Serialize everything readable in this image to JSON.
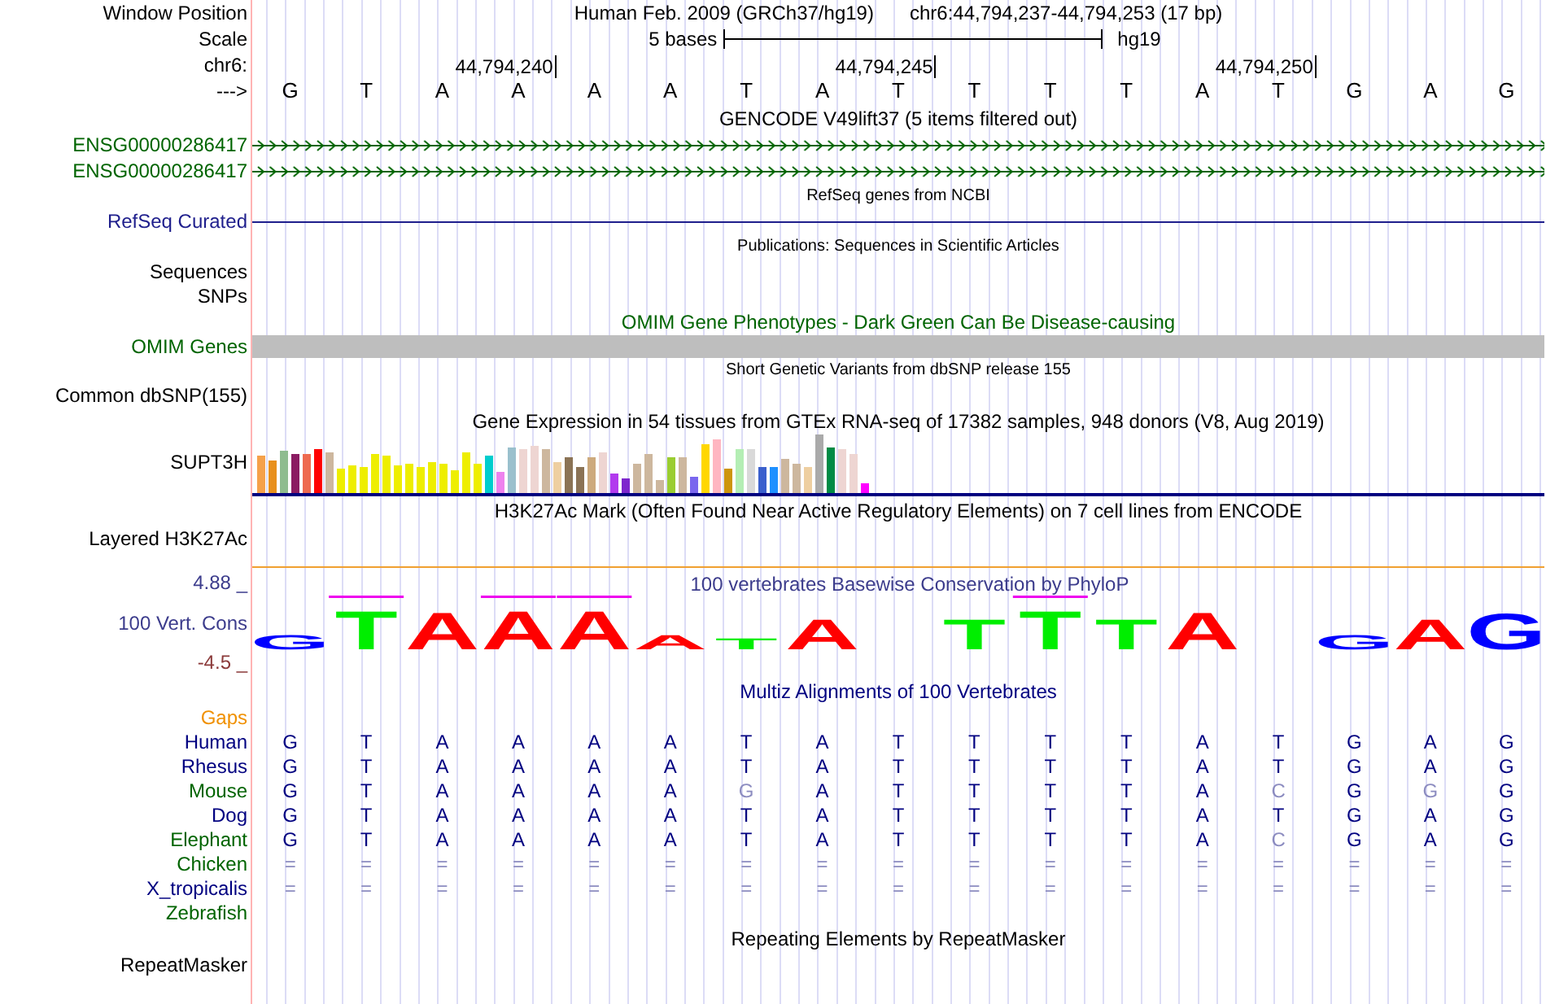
{
  "rows": [
    {
      "kind": "position",
      "label": "Window Position",
      "color": "#000000",
      "assembly": "Human Feb. 2009 (GRCh37/hg19)",
      "range": "chr6:44,794,237-44,794,253 (17 bp)"
    },
    {
      "kind": "scale",
      "label": "Scale",
      "color": "#000000",
      "span": "5 bases",
      "db": "hg19"
    },
    {
      "kind": "ticks",
      "label": "chr6:",
      "color": "#000000",
      "ticks": [
        "44,794,240",
        "44,794,245",
        "44,794,250"
      ]
    },
    {
      "kind": "bases",
      "label": "--->",
      "color": "#000000",
      "bases": [
        "G",
        "T",
        "A",
        "A",
        "A",
        "A",
        "T",
        "A",
        "T",
        "T",
        "T",
        "T",
        "A",
        "T",
        "G",
        "A",
        "G"
      ]
    },
    {
      "kind": "title",
      "text": "GENCODE V49lift37 (5 items filtered out)",
      "color": "#000000",
      "small": false
    },
    {
      "kind": "gene",
      "label": "ENSG00000286417",
      "color": "#006400"
    },
    {
      "kind": "gene",
      "label": "ENSG00000286417",
      "color": "#006400"
    },
    {
      "kind": "title",
      "text": "RefSeq genes from NCBI",
      "color": "#000000",
      "small": true
    },
    {
      "kind": "line",
      "label": "RefSeq Curated",
      "color": "#1e1e8c"
    },
    {
      "kind": "title",
      "text": "Publications: Sequences in Scientific Articles",
      "color": "#000000",
      "small": true
    },
    {
      "kind": "label",
      "label": "Sequences",
      "color": "#000000"
    },
    {
      "kind": "label",
      "label": "SNPs",
      "color": "#000000"
    },
    {
      "kind": "title",
      "text": "OMIM Gene Phenotypes - Dark Green Can Be Disease-causing",
      "color": "#006400",
      "small": false
    },
    {
      "kind": "band",
      "label": "OMIM Genes",
      "color": "#006400"
    },
    {
      "kind": "title",
      "text": "Short Genetic Variants from dbSNP release 155",
      "color": "#000000",
      "small": true
    },
    {
      "kind": "label",
      "label": "Common dbSNP(155)",
      "color": "#000000"
    },
    {
      "kind": "title",
      "text": "Gene Expression in 54 tissues from GTEx RNA-seq of 17382 samples, 948 donors (V8, Aug 2019)",
      "color": "#000000",
      "small": false
    },
    {
      "kind": "expression",
      "label": "SUPT3H",
      "color": "#000000",
      "bars": [
        {
          "color": "#f5a14a"
        },
        {
          "color": "#e8901c"
        },
        {
          "color": "#8fbc8f"
        },
        {
          "color": "#8b1c62"
        },
        {
          "color": "#ee6a50"
        },
        {
          "color": "#ff0000"
        },
        {
          "color": "#cdb79e"
        },
        {
          "color": "#eeee00"
        },
        {
          "color": "#eeee00"
        },
        {
          "color": "#eeee00"
        },
        {
          "color": "#eeee00"
        },
        {
          "color": "#eeee00"
        },
        {
          "color": "#eeee00"
        },
        {
          "color": "#eeee00"
        },
        {
          "color": "#eeee00"
        },
        {
          "color": "#eeee00"
        },
        {
          "color": "#eeee00"
        },
        {
          "color": "#eeee00"
        },
        {
          "color": "#eeee00"
        },
        {
          "color": "#eeee00"
        },
        {
          "color": "#00cdcd"
        },
        {
          "color": "#ee82ee"
        },
        {
          "color": "#9ac0cd"
        },
        {
          "color": "#eed5d2"
        },
        {
          "color": "#eed5d2"
        },
        {
          "color": "#cdb79e"
        },
        {
          "color": "#eecfa1"
        },
        {
          "color": "#8b7355"
        },
        {
          "color": "#8b7355"
        },
        {
          "color": "#cdaa7d"
        },
        {
          "color": "#eed5d2"
        },
        {
          "color": "#b23aee"
        },
        {
          "color": "#7d26cd"
        },
        {
          "color": "#cdb79e"
        },
        {
          "color": "#cdb79e"
        },
        {
          "color": "#cdb79e"
        },
        {
          "color": "#9acd32"
        },
        {
          "color": "#cdb79e"
        },
        {
          "color": "#7a67ee"
        },
        {
          "color": "#ffd700"
        },
        {
          "color": "#ffb6c1"
        },
        {
          "color": "#cd950c"
        },
        {
          "color": "#b4eeb4"
        },
        {
          "color": "#d9d9d9"
        },
        {
          "color": "#3a5fcd"
        },
        {
          "color": "#1e90ff"
        },
        {
          "color": "#cdb79e"
        },
        {
          "color": "#cdb79e"
        },
        {
          "color": "#eecfa1"
        },
        {
          "color": "#aaaaaa"
        },
        {
          "color": "#008b45"
        },
        {
          "color": "#eed5d2"
        },
        {
          "color": "#eed5d2"
        },
        {
          "color": "#ff00ff"
        }
      ]
    },
    {
      "kind": "title",
      "text": "H3K27Ac Mark (Often Found Near Active Regulatory Elements) on 7 cell lines from ENCODE",
      "color": "#000000",
      "small": false
    },
    {
      "kind": "signal",
      "label": "Layered H3K27Ac",
      "color": "#000000"
    },
    {
      "kind": "logo",
      "label": "100 Vert. Cons",
      "color": "#3c3c8c",
      "title": "100 vertebrates Basewise Conservation by PhyloP",
      "max": "4.88 _",
      "min": "-4.5 _",
      "letters": [
        {
          "kind": "letter",
          "base": "G",
          "color": "#0000ff"
        },
        {
          "kind": "letter",
          "base": "T",
          "color": "#00ee00"
        },
        {
          "kind": "letter",
          "base": "A",
          "color": "#ff0000"
        },
        {
          "kind": "letter",
          "base": "A",
          "color": "#ff0000"
        },
        {
          "kind": "letter",
          "base": "A",
          "color": "#ff0000"
        },
        {
          "kind": "letter",
          "base": "A",
          "color": "#ff0000"
        },
        {
          "kind": "letter",
          "base": "T",
          "color": "#00ee00"
        },
        {
          "kind": "letter",
          "base": "A",
          "color": "#ff0000"
        },
        {
          "kind": "gap"
        },
        {
          "kind": "letter",
          "base": "T",
          "color": "#00ee00"
        },
        {
          "kind": "letter",
          "base": "T",
          "color": "#00ee00"
        },
        {
          "kind": "letter",
          "base": "T",
          "color": "#00ee00"
        },
        {
          "kind": "letter",
          "base": "A",
          "color": "#ff0000"
        },
        {
          "kind": "gap"
        },
        {
          "kind": "letter",
          "base": "G",
          "color": "#0000ff"
        },
        {
          "kind": "letter",
          "base": "A",
          "color": "#ff0000"
        },
        {
          "kind": "letter",
          "base": "G",
          "color": "#0000ff"
        }
      ]
    },
    {
      "kind": "title",
      "text": "Multiz Alignments of 100 Vertebrates",
      "color": "#000080",
      "small": false
    },
    {
      "kind": "label",
      "label": "Gaps",
      "color": "#f09000"
    },
    {
      "kind": "alignment",
      "label": "Human",
      "color": "#000080",
      "bases": [
        {
          "b": "G",
          "mismatch": false
        },
        {
          "b": "T",
          "mismatch": false
        },
        {
          "b": "A",
          "mismatch": false
        },
        {
          "b": "A",
          "mismatch": false
        },
        {
          "b": "A",
          "mismatch": false
        },
        {
          "b": "A",
          "mismatch": false
        },
        {
          "b": "T",
          "mismatch": false
        },
        {
          "b": "A",
          "mismatch": false
        },
        {
          "b": "T",
          "mismatch": false
        },
        {
          "b": "T",
          "mismatch": false
        },
        {
          "b": "T",
          "mismatch": false
        },
        {
          "b": "T",
          "mismatch": false
        },
        {
          "b": "A",
          "mismatch": false
        },
        {
          "b": "T",
          "mismatch": false
        },
        {
          "b": "G",
          "mismatch": false
        },
        {
          "b": "A",
          "mismatch": false
        },
        {
          "b": "G",
          "mismatch": false
        }
      ]
    },
    {
      "kind": "alignment",
      "label": "Rhesus",
      "color": "#000080",
      "bases": [
        {
          "b": "G",
          "mismatch": false
        },
        {
          "b": "T",
          "mismatch": false
        },
        {
          "b": "A",
          "mismatch": false
        },
        {
          "b": "A",
          "mismatch": false
        },
        {
          "b": "A",
          "mismatch": false
        },
        {
          "b": "A",
          "mismatch": false
        },
        {
          "b": "T",
          "mismatch": false
        },
        {
          "b": "A",
          "mismatch": false
        },
        {
          "b": "T",
          "mismatch": false
        },
        {
          "b": "T",
          "mismatch": false
        },
        {
          "b": "T",
          "mismatch": false
        },
        {
          "b": "T",
          "mismatch": false
        },
        {
          "b": "A",
          "mismatch": false
        },
        {
          "b": "T",
          "mismatch": false
        },
        {
          "b": "G",
          "mismatch": false
        },
        {
          "b": "A",
          "mismatch": false
        },
        {
          "b": "G",
          "mismatch": false
        }
      ]
    },
    {
      "kind": "alignment",
      "label": "Mouse",
      "color": "#006400",
      "bases": [
        {
          "b": "G",
          "mismatch": false
        },
        {
          "b": "T",
          "mismatch": false
        },
        {
          "b": "A",
          "mismatch": false
        },
        {
          "b": "A",
          "mismatch": false
        },
        {
          "b": "A",
          "mismatch": false
        },
        {
          "b": "A",
          "mismatch": false
        },
        {
          "b": "G",
          "mismatch": true
        },
        {
          "b": "A",
          "mismatch": false
        },
        {
          "b": "T",
          "mismatch": false
        },
        {
          "b": "T",
          "mismatch": false
        },
        {
          "b": "T",
          "mismatch": false
        },
        {
          "b": "T",
          "mismatch": false
        },
        {
          "b": "A",
          "mismatch": false
        },
        {
          "b": "C",
          "mismatch": true
        },
        {
          "b": "G",
          "mismatch": false
        },
        {
          "b": "G",
          "mismatch": true
        },
        {
          "b": "G",
          "mismatch": false
        }
      ]
    },
    {
      "kind": "alignment",
      "label": "Dog",
      "color": "#000080",
      "bases": [
        {
          "b": "G",
          "mismatch": false
        },
        {
          "b": "T",
          "mismatch": false
        },
        {
          "b": "A",
          "mismatch": false
        },
        {
          "b": "A",
          "mismatch": false
        },
        {
          "b": "A",
          "mismatch": false
        },
        {
          "b": "A",
          "mismatch": false
        },
        {
          "b": "T",
          "mismatch": false
        },
        {
          "b": "A",
          "mismatch": false
        },
        {
          "b": "T",
          "mismatch": false
        },
        {
          "b": "T",
          "mismatch": false
        },
        {
          "b": "T",
          "mismatch": false
        },
        {
          "b": "T",
          "mismatch": false
        },
        {
          "b": "A",
          "mismatch": false
        },
        {
          "b": "T",
          "mismatch": false
        },
        {
          "b": "G",
          "mismatch": false
        },
        {
          "b": "A",
          "mismatch": false
        },
        {
          "b": "G",
          "mismatch": false
        }
      ]
    },
    {
      "kind": "alignment",
      "label": "Elephant",
      "color": "#006400",
      "bases": [
        {
          "b": "G",
          "mismatch": false
        },
        {
          "b": "T",
          "mismatch": false
        },
        {
          "b": "A",
          "mismatch": false
        },
        {
          "b": "A",
          "mismatch": false
        },
        {
          "b": "A",
          "mismatch": false
        },
        {
          "b": "A",
          "mismatch": false
        },
        {
          "b": "T",
          "mismatch": false
        },
        {
          "b": "A",
          "mismatch": false
        },
        {
          "b": "T",
          "mismatch": false
        },
        {
          "b": "T",
          "mismatch": false
        },
        {
          "b": "T",
          "mismatch": false
        },
        {
          "b": "T",
          "mismatch": false
        },
        {
          "b": "A",
          "mismatch": false
        },
        {
          "b": "C",
          "mismatch": true
        },
        {
          "b": "G",
          "mismatch": false
        },
        {
          "b": "A",
          "mismatch": false
        },
        {
          "b": "G",
          "mismatch": false
        }
      ]
    },
    {
      "kind": "alignment",
      "label": "Chicken",
      "color": "#006400",
      "bases": [
        {
          "b": "=",
          "mismatch": true
        },
        {
          "b": "=",
          "mismatch": true
        },
        {
          "b": "=",
          "mismatch": true
        },
        {
          "b": "=",
          "mismatch": true
        },
        {
          "b": "=",
          "mismatch": true
        },
        {
          "b": "=",
          "mismatch": true
        },
        {
          "b": "=",
          "mismatch": true
        },
        {
          "b": "=",
          "mismatch": true
        },
        {
          "b": "=",
          "mismatch": true
        },
        {
          "b": "=",
          "mismatch": true
        },
        {
          "b": "=",
          "mismatch": true
        },
        {
          "b": "=",
          "mismatch": true
        },
        {
          "b": "=",
          "mismatch": true
        },
        {
          "b": "=",
          "mismatch": true
        },
        {
          "b": "=",
          "mismatch": true
        },
        {
          "b": "=",
          "mismatch": true
        },
        {
          "b": "=",
          "mismatch": true
        }
      ]
    },
    {
      "kind": "alignment",
      "label": "X_tropicalis",
      "color": "#000080",
      "bases": [
        {
          "b": "=",
          "mismatch": true
        },
        {
          "b": "=",
          "mismatch": true
        },
        {
          "b": "=",
          "mismatch": true
        },
        {
          "b": "=",
          "mismatch": true
        },
        {
          "b": "=",
          "mismatch": true
        },
        {
          "b": "=",
          "mismatch": true
        },
        {
          "b": "=",
          "mismatch": true
        },
        {
          "b": "=",
          "mismatch": true
        },
        {
          "b": "=",
          "mismatch": true
        },
        {
          "b": "=",
          "mismatch": true
        },
        {
          "b": "=",
          "mismatch": true
        },
        {
          "b": "=",
          "mismatch": true
        },
        {
          "b": "=",
          "mismatch": true
        },
        {
          "b": "=",
          "mismatch": true
        },
        {
          "b": "=",
          "mismatch": true
        },
        {
          "b": "=",
          "mismatch": true
        },
        {
          "b": "=",
          "mismatch": true
        }
      ]
    },
    {
      "kind": "label",
      "label": "Zebrafish",
      "color": "#006400"
    },
    {
      "kind": "title",
      "text": "Repeating Elements by RepeatMasker",
      "color": "#000000",
      "small": false
    },
    {
      "kind": "label",
      "label": "RepeatMasker",
      "color": "#000000"
    }
  ]
}
